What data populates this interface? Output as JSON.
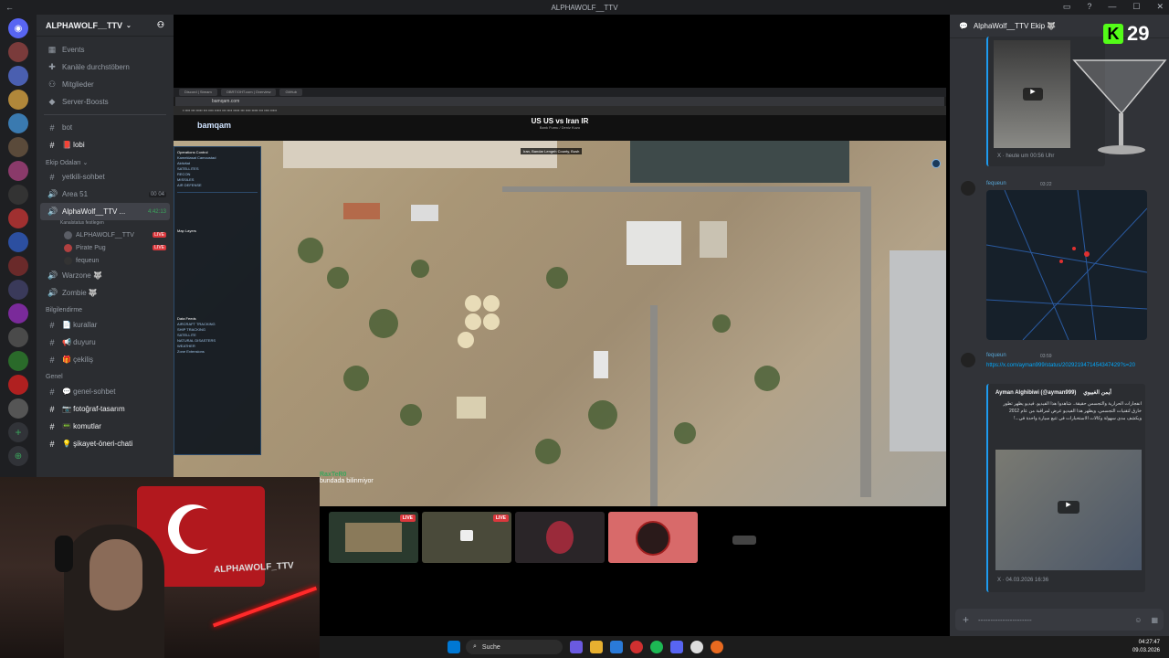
{
  "titlebar": {
    "title": "ALPHAWOLF__TTV"
  },
  "guild": {
    "name": "ALPHAWOLF__TTV"
  },
  "sidebar_top": [
    {
      "icon": "calendar-icon",
      "label": "Events"
    },
    {
      "icon": "compass-icon",
      "label": "Kanäle durchstöbern"
    },
    {
      "icon": "members-icon",
      "label": "Mitglieder"
    },
    {
      "icon": "boost-icon",
      "label": "Server-Boosts"
    }
  ],
  "channels_top": [
    {
      "label": "bot"
    },
    {
      "label": "📕 lobi"
    }
  ],
  "category_voice": "Ekip Odaları",
  "channels_voice": [
    {
      "label": "yetkili-sohbet"
    },
    {
      "label": "Area 51",
      "count": "00",
      "limit": "04"
    }
  ],
  "active_voice": {
    "label": "AlphaWolf__TTV ...",
    "timer": "4:42:13",
    "status": "Kanalstatus festlegen"
  },
  "voice_users": [
    {
      "name": "ALPHAWOLF__TTV",
      "badge": "LIVE"
    },
    {
      "name": "Pirate Pug",
      "badge": "LIVE"
    },
    {
      "name": "fequeun",
      "badge": ""
    }
  ],
  "channels_voice2": [
    {
      "label": "Warzone 🐺"
    },
    {
      "label": "Zombie 🐺"
    }
  ],
  "category_info": "Bilgilendirme",
  "channels_info": [
    {
      "label": "📄 kurallar"
    },
    {
      "label": "📢 duyuru"
    },
    {
      "label": "🎁 çekiliş"
    }
  ],
  "category_general": "Genel",
  "channels_general": [
    {
      "label": "💬 genel-sohbet"
    },
    {
      "label": "📷 fotoğraf-tasarım"
    },
    {
      "label": "📟 komutlar"
    },
    {
      "label": "💡 şikayet-öneri-chati"
    }
  ],
  "stream": {
    "tabs": [
      "Discord | Stream",
      "OBRT/OHT.com | Overview",
      "GitHub"
    ],
    "url": "bamqam.com",
    "logo": "bamqam",
    "map_title": "US US vs Iran IR",
    "map_subtitle": "Bank Fumu / Deniz Kuzo",
    "location": "Iran, Bandar Lengeh County, Bush",
    "panel_heading": "Operations Control",
    "panel_items": [
      "Kameklasat Camoustad",
      "Aktivitat",
      "SATELLITES",
      "RECON",
      "MISSILES",
      "AIR DEFENSE",
      "Map Layers",
      "Data Feeds",
      "AIRCRAFT TRACKING",
      "SHIP TRACKING",
      "SATELLITE",
      "NATURAL DISASTERS",
      "WEATHER",
      "Zone Extensions"
    ],
    "chat_user": "RaxTeR0",
    "chat_text": "bundada bilinmiyor"
  },
  "tiles": [
    {
      "live": "LIVE"
    },
    {
      "live": "LIVE"
    },
    {
      "live": ""
    },
    {
      "live": ""
    }
  ],
  "webcam": {
    "overlay_text": "ALPHAWOLF_TTV"
  },
  "thread": {
    "title": "AlphaWolf__TTV Ekip 🐺",
    "embed1_time": "X · heute um 00:56 Uhr",
    "msg2_user": "fequeun",
    "msg2_time": "03:22",
    "msg3_user": "fequeun",
    "msg3_time": "03:59",
    "msg3_link": "https://x.com/ayman999/status/2029219471454347429?s=20",
    "embed3_author": "Ayman Alghibiwi (@ayman999)",
    "embed3_author_ar": "أيمن الغبيوي",
    "embed3_text": "انفجارات الحرارية والتجسس حقيقة.. شاهدوا هذا الفيديو. فيديو يظهر تطور خارق لتقنيات التجسس، ويظهر هذا الفيديو عرض لمراقبة من عام 2012 ويكشف مدى سهولة وكالات الاستخبارات في تتبع سيارة واحدة في...!",
    "embed3_footer": "X · 04.03.2026 16:36",
    "composer_placeholder": "----------------------"
  },
  "overlay_counter": "29",
  "taskbar": {
    "search": "Suche",
    "time": "04:27:47",
    "date": "09.03.2026"
  }
}
